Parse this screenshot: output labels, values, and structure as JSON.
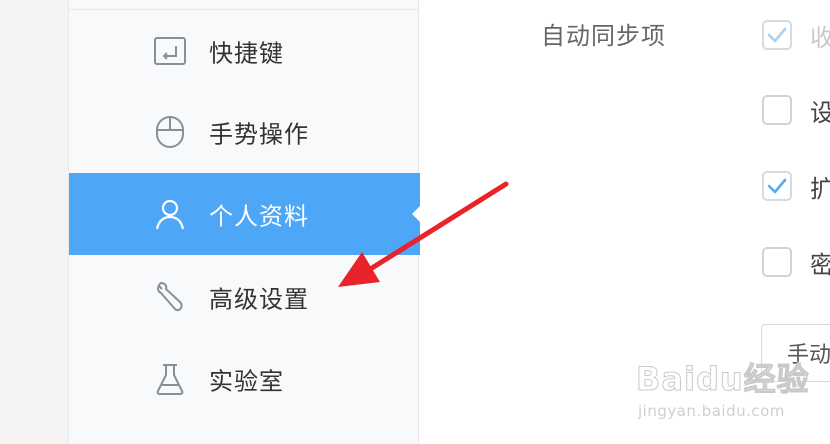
{
  "sidebar": {
    "items": [
      {
        "label": "快捷键",
        "icon": "keyboard-shortcut-icon",
        "active": false
      },
      {
        "label": "手势操作",
        "icon": "mouse-icon",
        "active": false
      },
      {
        "label": "个人资料",
        "icon": "user-icon",
        "active": true
      },
      {
        "label": "高级设置",
        "icon": "wrench-icon",
        "active": false
      },
      {
        "label": "实验室",
        "icon": "flask-icon",
        "active": false
      }
    ]
  },
  "sync": {
    "title": "自动同步项",
    "options": [
      {
        "label": "收",
        "checked": true,
        "disabled": true
      },
      {
        "label": "设",
        "checked": false,
        "disabled": false
      },
      {
        "label": "扩",
        "checked": true,
        "disabled": false
      },
      {
        "label": "密",
        "checked": false,
        "disabled": false
      }
    ],
    "manual_button_label": "手动"
  },
  "watermark": {
    "main": "Baidu经验",
    "sub": "jingyan.baidu.com"
  },
  "colors": {
    "accent": "#4ea6f7",
    "annotation_arrow": "#e8232a",
    "check_mark": "#5aa8f0"
  }
}
